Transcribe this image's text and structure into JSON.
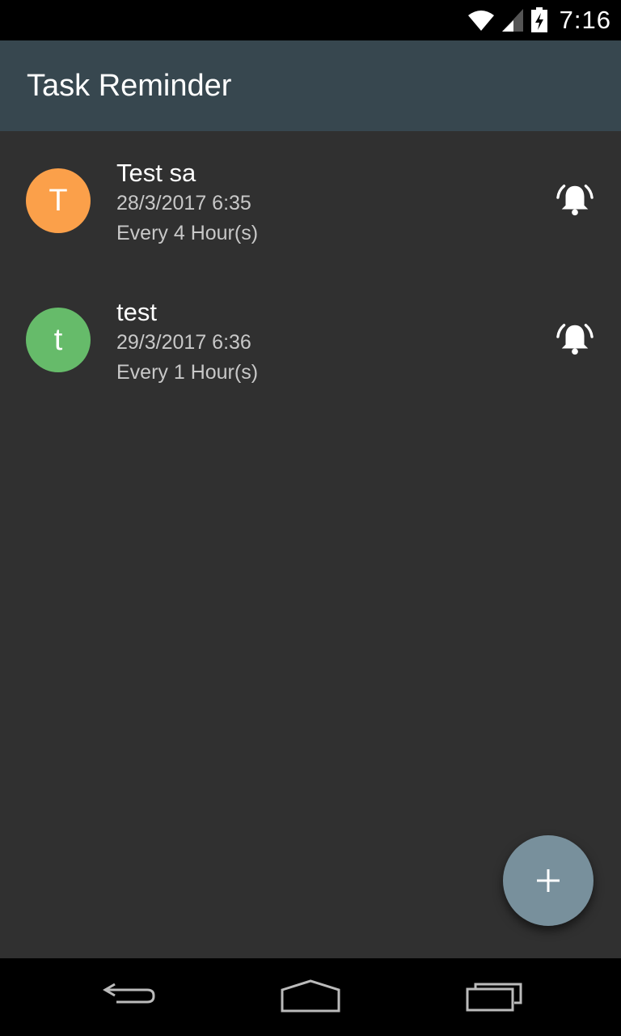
{
  "status_bar": {
    "time": "7:16",
    "icons": [
      "wifi-icon",
      "cell-signal-icon",
      "battery-charging-icon"
    ]
  },
  "app_bar": {
    "title": "Task Reminder",
    "color": "#37474f"
  },
  "tasks": [
    {
      "initial": "T",
      "avatar_color": "#fba04a",
      "title": "Test sa",
      "datetime": "28/3/2017 6:35",
      "repeat": "Every 4 Hour(s)",
      "icon": "alarm-on-icon"
    },
    {
      "initial": "t",
      "avatar_color": "#66bb6a",
      "title": "test",
      "datetime": "29/3/2017 6:36",
      "repeat": "Every 1 Hour(s)",
      "icon": "alarm-on-icon"
    }
  ],
  "fab": {
    "icon": "plus-icon",
    "color": "#78909c"
  },
  "nav_bar": {
    "icons": [
      "back-icon",
      "home-icon",
      "recents-icon"
    ]
  }
}
